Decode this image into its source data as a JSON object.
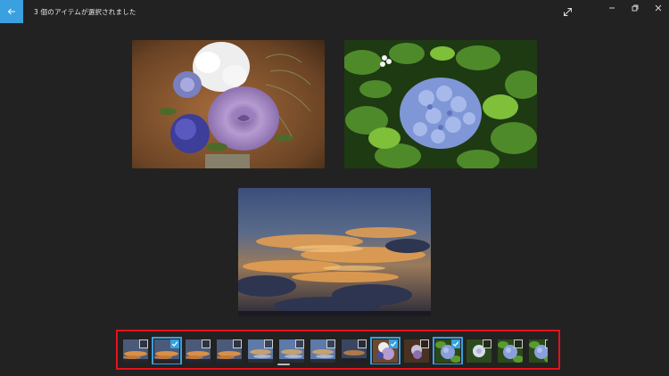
{
  "header": {
    "title": "3 個のアイテムが選択されました",
    "accent": "#3aa0e0"
  },
  "icons": {
    "back": "arrow-left-icon",
    "expand": "expand-diagonal-icon",
    "minimize": "minimize-icon",
    "restore": "restore-icon",
    "close": "close-icon"
  },
  "photos": [
    {
      "subject": "rose-bouquet"
    },
    {
      "subject": "hydrangea"
    },
    {
      "subject": "sunset-clouds"
    }
  ],
  "filmstrip": {
    "highlight_color": "#e8101a",
    "thumbs": [
      {
        "kind": "sky",
        "checked": false
      },
      {
        "kind": "sky",
        "checked": true
      },
      {
        "kind": "sky",
        "checked": false
      },
      {
        "kind": "sky",
        "checked": false
      },
      {
        "kind": "sky-blue",
        "checked": false
      },
      {
        "kind": "sky-blue",
        "checked": false
      },
      {
        "kind": "sky-blue",
        "checked": false
      },
      {
        "kind": "sky-dark",
        "checked": false
      },
      {
        "kind": "rose",
        "checked": true
      },
      {
        "kind": "rose-dark",
        "checked": false
      },
      {
        "kind": "hydrangea",
        "checked": true
      },
      {
        "kind": "flower-white",
        "checked": false
      },
      {
        "kind": "hydrangea",
        "checked": false
      },
      {
        "kind": "hydrangea",
        "checked": false
      }
    ]
  }
}
